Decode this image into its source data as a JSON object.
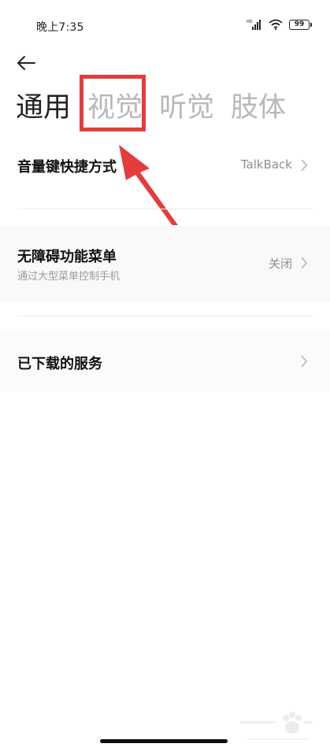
{
  "status_bar": {
    "time": "晚上7:35",
    "battery": "99",
    "icons": [
      "hd-signal-icon",
      "wifi-icon",
      "battery-icon"
    ]
  },
  "header": {
    "back_icon": "arrow-left-icon"
  },
  "tabs": [
    {
      "label": "通用",
      "active": true
    },
    {
      "label": "视觉",
      "active": false
    },
    {
      "label": "听觉",
      "active": false
    },
    {
      "label": "肢体",
      "active": false
    }
  ],
  "settings": [
    {
      "title": "音量键快捷方式",
      "value": "TalkBack"
    },
    {
      "title": "无障碍功能菜单",
      "subtitle": "通过大型菜单控制手机",
      "value": "关闭"
    },
    {
      "title": "已下载的服务"
    }
  ],
  "annotation": {
    "color": "#e53b3b"
  }
}
